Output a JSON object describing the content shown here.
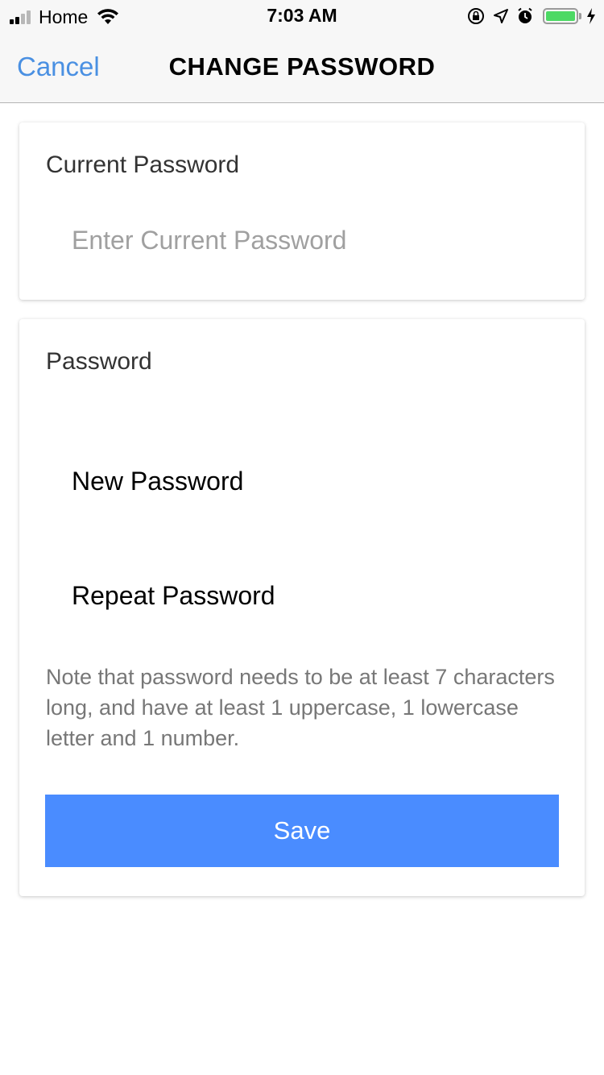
{
  "status_bar": {
    "carrier": "Home",
    "time": "7:03 AM",
    "battery_level": 1.0,
    "battery_color": "#4cd964",
    "icons": [
      "signal-icon",
      "wifi-icon",
      "rotation-lock-icon",
      "location-icon",
      "alarm-icon",
      "battery-icon",
      "charging-icon"
    ]
  },
  "nav": {
    "cancel_label": "Cancel",
    "title": "CHANGE PASSWORD"
  },
  "current_section": {
    "label": "Current Password",
    "input_placeholder": "Enter Current Password",
    "input_value": ""
  },
  "password_section": {
    "label": "Password",
    "new_placeholder": "New Password",
    "new_value": "",
    "repeat_placeholder": "Repeat Password",
    "repeat_value": "",
    "note": "Note that password needs to be at least 7 characters long, and have at least 1 uppercase, 1 lowercase letter and 1 number.",
    "save_label": "Save"
  },
  "colors": {
    "accent": "#4a90e2",
    "button": "#4a8cff"
  }
}
